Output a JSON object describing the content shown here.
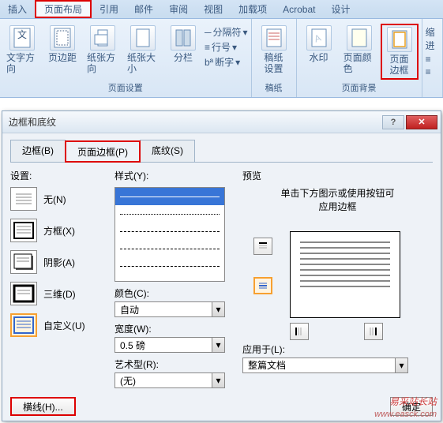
{
  "ribbon": {
    "tabs": [
      "插入",
      "页面布局",
      "引用",
      "邮件",
      "审阅",
      "视图",
      "加载项",
      "Acrobat",
      "设计"
    ],
    "active_tab": "页面布局",
    "groups": {
      "page_setup": {
        "label": "页面设置",
        "text_direction": "文字方向",
        "margins": "页边距",
        "orientation": "纸张方向",
        "size": "纸张大小",
        "columns": "分栏",
        "breaks": "分隔符",
        "line_numbers": "行号",
        "hyphenation": "断字"
      },
      "manuscript": {
        "label": "稿纸",
        "settings": "稿纸\n设置"
      },
      "background": {
        "label": "页面背景",
        "watermark": "水印",
        "page_color": "页面颜色",
        "page_border": "页面\n边框"
      },
      "indent": {
        "label": "缩进"
      }
    }
  },
  "dialog": {
    "title": "边框和底纹",
    "help": "?",
    "close": "✕",
    "tabs": {
      "borders": "边框(B)",
      "page_border": "页面边框(P)",
      "shading": "底纹(S)"
    },
    "settings": {
      "heading": "设置:",
      "none": "无(N)",
      "box": "方框(X)",
      "shadow": "阴影(A)",
      "three_d": "三维(D)",
      "custom": "自定义(U)"
    },
    "style": {
      "heading": "样式(Y):",
      "color_label": "颜色(C):",
      "color_value": "自动",
      "width_label": "宽度(W):",
      "width_value": "0.5 磅",
      "art_label": "艺术型(R):",
      "art_value": "(无)"
    },
    "preview": {
      "heading": "预览",
      "hint": "单击下方图示或使用按钮可\n应用边框",
      "apply_label": "应用于(L):",
      "apply_value": "整篇文档"
    },
    "footer": {
      "hline": "横线(H)...",
      "ok": "确定"
    }
  },
  "watermark": {
    "text": "易采站长站",
    "url": "www.easck.com"
  }
}
